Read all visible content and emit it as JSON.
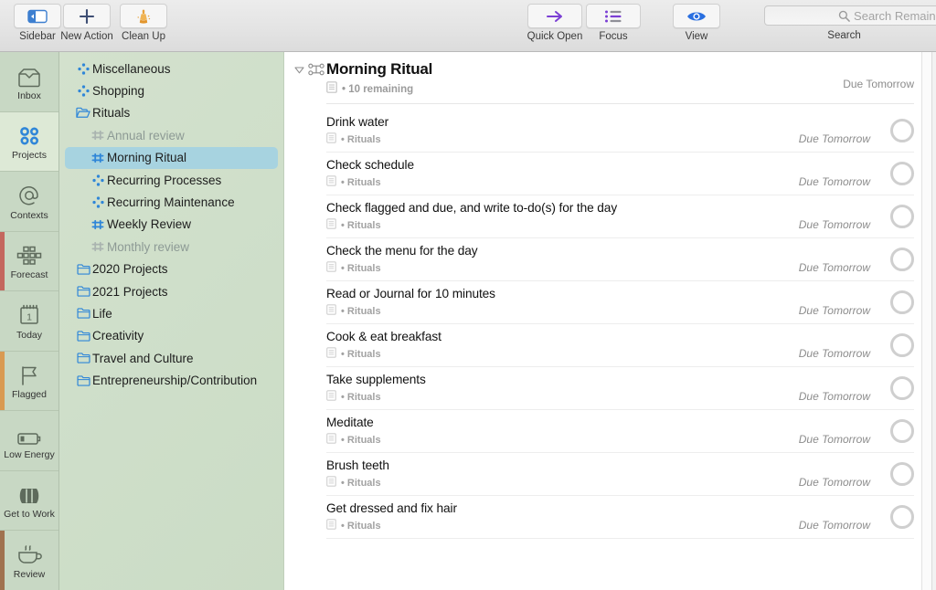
{
  "toolbar": {
    "items": [
      {
        "label": "Sidebar",
        "icon": "sidebar-icon"
      },
      {
        "label": "New Action",
        "icon": "plus-icon"
      },
      {
        "label": "Clean Up",
        "icon": "broom-icon"
      },
      {
        "label": "Quick Open",
        "icon": "arrow-right-icon"
      },
      {
        "label": "Focus",
        "icon": "list-icon"
      },
      {
        "label": "View",
        "icon": "eye-icon"
      }
    ],
    "search": {
      "placeholder": "Search Remaining",
      "label": "Search",
      "value": "",
      "icon": "search-icon"
    }
  },
  "perspectives": [
    {
      "label": "Inbox",
      "icon": "inbox-icon",
      "selected": false,
      "accent": ""
    },
    {
      "label": "Projects",
      "icon": "projects-dots-icon",
      "selected": true,
      "accent": ""
    },
    {
      "label": "Contexts",
      "icon": "at-sign-icon",
      "selected": false,
      "accent": ""
    },
    {
      "label": "Forecast",
      "icon": "forecast-grid-icon",
      "selected": false,
      "accent": "#c4675e"
    },
    {
      "label": "Today",
      "icon": "calendar-icon",
      "selected": false,
      "accent": ""
    },
    {
      "label": "Flagged",
      "icon": "flag-icon",
      "selected": false,
      "accent": "#d99a52"
    },
    {
      "label": "Low Energy",
      "icon": "battery-icon",
      "selected": false,
      "accent": ""
    },
    {
      "label": "Get to Work",
      "icon": "barrel-icon",
      "selected": false,
      "accent": ""
    },
    {
      "label": "Review",
      "icon": "coffee-cup-icon",
      "selected": false,
      "accent": "#a0724f"
    }
  ],
  "outline": [
    {
      "label": "Miscellaneous",
      "icon": "parallel-project-icon",
      "indent": 0,
      "selected": false,
      "dim": false
    },
    {
      "label": "Shopping",
      "icon": "parallel-project-icon",
      "indent": 0,
      "selected": false,
      "dim": false
    },
    {
      "label": "Rituals",
      "icon": "folder-open-icon",
      "indent": 0,
      "selected": false,
      "dim": false
    },
    {
      "label": "Annual review",
      "icon": "sequential-project-icon",
      "indent": 1,
      "selected": false,
      "dim": true
    },
    {
      "label": "Morning Ritual",
      "icon": "sequential-project-icon",
      "indent": 1,
      "selected": true,
      "dim": false
    },
    {
      "label": "Recurring Processes",
      "icon": "parallel-project-icon",
      "indent": 1,
      "selected": false,
      "dim": false
    },
    {
      "label": "Recurring Maintenance",
      "icon": "parallel-project-icon",
      "indent": 1,
      "selected": false,
      "dim": false
    },
    {
      "label": "Weekly Review",
      "icon": "sequential-project-icon",
      "indent": 1,
      "selected": false,
      "dim": false
    },
    {
      "label": "Monthly review",
      "icon": "sequential-project-icon",
      "indent": 1,
      "selected": false,
      "dim": true
    },
    {
      "label": "2020 Projects",
      "icon": "folder-icon",
      "indent": 0,
      "selected": false,
      "dim": false
    },
    {
      "label": "2021 Projects",
      "icon": "folder-icon",
      "indent": 0,
      "selected": false,
      "dim": false
    },
    {
      "label": "Life",
      "icon": "folder-icon",
      "indent": 0,
      "selected": false,
      "dim": false
    },
    {
      "label": "Creativity",
      "icon": "folder-icon",
      "indent": 0,
      "selected": false,
      "dim": false
    },
    {
      "label": "Travel and Culture",
      "icon": "folder-icon",
      "indent": 0,
      "selected": false,
      "dim": false
    },
    {
      "label": "Entrepreneurship/Contribution",
      "icon": "folder-icon",
      "indent": 0,
      "selected": false,
      "dim": false
    }
  ],
  "project": {
    "title": "Morning Ritual",
    "status": "• 10 remaining",
    "due": "Due Tomorrow",
    "disclosure": "triangle-down-icon",
    "type_icon": "sequential-project-icon",
    "note_icon": "note-icon"
  },
  "tasks": [
    {
      "title": "Drink water",
      "context": "• Rituals",
      "due": "Due Tomorrow"
    },
    {
      "title": "Check schedule",
      "context": "• Rituals",
      "due": "Due Tomorrow"
    },
    {
      "title": "Check flagged and due, and write to-do(s) for the day",
      "context": "• Rituals",
      "due": "Due Tomorrow"
    },
    {
      "title": "Check the menu for the day",
      "context": "• Rituals",
      "due": "Due Tomorrow"
    },
    {
      "title": "Read or Journal for 10 minutes",
      "context": "• Rituals",
      "due": "Due Tomorrow"
    },
    {
      "title": "Cook & eat breakfast",
      "context": "• Rituals",
      "due": "Due Tomorrow"
    },
    {
      "title": "Take supplements",
      "context": "• Rituals",
      "due": "Due Tomorrow"
    },
    {
      "title": "Meditate",
      "context": "• Rituals",
      "due": "Due Tomorrow"
    },
    {
      "title": "Brush teeth",
      "context": "• Rituals",
      "due": "Due Tomorrow"
    },
    {
      "title": "Get dressed and fix hair",
      "context": "• Rituals",
      "due": "Due Tomorrow"
    }
  ],
  "colors": {
    "sidebar_green": "#cfdfca",
    "rail_green": "#c8d8c4",
    "selection_blue": "#a7d3e0",
    "project_icon_blue": "#2f86d8",
    "accent_forecast": "#c4675e",
    "accent_flagged": "#d99a52",
    "accent_review": "#a0724f",
    "quick_open_purple": "#7b3fd4",
    "view_blue": "#2a6fe0"
  }
}
